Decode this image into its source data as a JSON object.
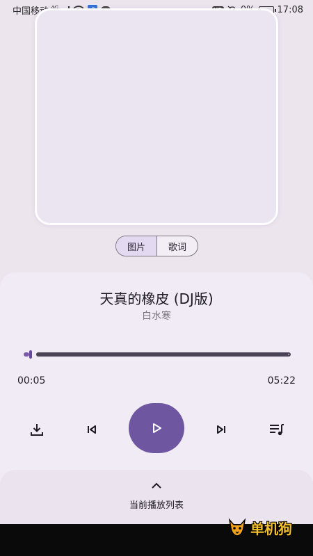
{
  "status_bar": {
    "carrier": "中国移动",
    "network": "4G",
    "battery_percent": "0%",
    "time": "17:08",
    "hd_label": "HD",
    "icons": [
      "signal-icon",
      "wifi-icon",
      "music-notification-icon",
      "message-icon",
      "hd-icon",
      "mute-icon",
      "battery-icon"
    ]
  },
  "view_toggle": {
    "image_label": "图片",
    "lyrics_label": "歌词",
    "selected": "图片"
  },
  "track": {
    "title": "天真的橡皮 (DJ版)",
    "artist": "白水寒",
    "current_time": "00:05",
    "total_time": "05:22",
    "progress_fraction": 0.016
  },
  "controls": {
    "icons": [
      "download-icon",
      "previous-icon",
      "play-icon",
      "next-icon",
      "queue-icon"
    ]
  },
  "playlist": {
    "label": "当前播放列表"
  },
  "watermark": {
    "text": "单机狗"
  },
  "colors": {
    "accent": "#6e56a1",
    "background": "#ece5ee",
    "sheet": "#f0ebf4"
  }
}
